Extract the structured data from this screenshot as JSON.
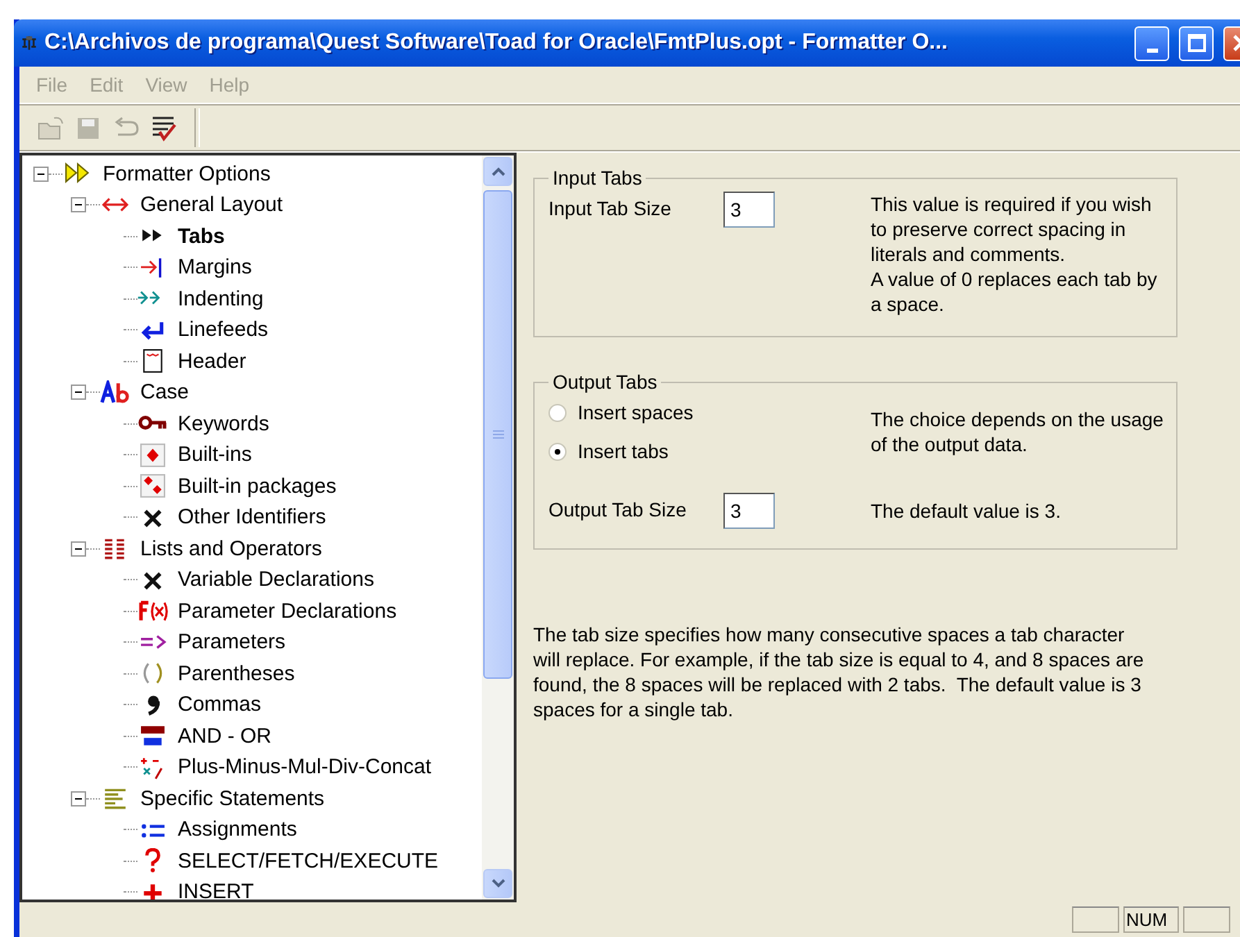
{
  "window": {
    "title": "C:\\Archivos de programa\\Quest Software\\Toad for Oracle\\FmtPlus.opt - Formatter O..."
  },
  "menu": [
    {
      "label": "File",
      "disabled": true
    },
    {
      "label": "Edit",
      "disabled": true
    },
    {
      "label": "View",
      "disabled": true
    },
    {
      "label": "Help",
      "disabled": true
    }
  ],
  "toolbar": [
    {
      "disabled": true
    },
    {
      "disabled": true
    },
    {
      "disabled": true
    },
    {
      "disabled": false
    }
  ],
  "tree": [
    {
      "label": "Formatter Options",
      "expanded": true,
      "selected": false,
      "children": [
        {
          "label": "General Layout",
          "expanded": true,
          "selected": false,
          "children": [
            {
              "label": "Tabs",
              "selected": true
            },
            {
              "label": "Margins",
              "selected": false
            },
            {
              "label": "Indenting",
              "selected": false
            },
            {
              "label": "Linefeeds",
              "selected": false
            },
            {
              "label": "Header",
              "selected": false
            }
          ]
        },
        {
          "label": "Case",
          "expanded": true,
          "selected": false,
          "children": [
            {
              "label": "Keywords",
              "selected": false
            },
            {
              "label": "Built-ins",
              "selected": false
            },
            {
              "label": "Built-in packages",
              "selected": false
            },
            {
              "label": "Other Identifiers",
              "selected": false
            }
          ]
        },
        {
          "label": "Lists and Operators",
          "expanded": true,
          "selected": false,
          "children": [
            {
              "label": "Variable Declarations",
              "selected": false
            },
            {
              "label": "Parameter Declarations",
              "selected": false
            },
            {
              "label": "Parameters",
              "selected": false
            },
            {
              "label": "Parentheses",
              "selected": false
            },
            {
              "label": "Commas",
              "selected": false
            },
            {
              "label": "AND - OR",
              "selected": false
            },
            {
              "label": "Plus-Minus-Mul-Div-Concat",
              "selected": false
            }
          ]
        },
        {
          "label": "Specific Statements",
          "expanded": true,
          "selected": false,
          "children": [
            {
              "label": "Assignments",
              "selected": false
            },
            {
              "label": "SELECT/FETCH/EXECUTE",
              "selected": false
            },
            {
              "label": "INSERT",
              "selected": false
            }
          ]
        }
      ]
    }
  ],
  "input_tabs": {
    "title": "Input Tabs",
    "size_label": "Input Tab Size",
    "size_value": "3",
    "description": "This value is required if you wish to preserve correct spacing in literals and comments.\nA value of 0 replaces each tab by a space."
  },
  "output_tabs": {
    "title": "Output Tabs",
    "options": [
      {
        "label": "Insert spaces",
        "selected": false
      },
      {
        "label": "Insert tabs",
        "selected": true
      }
    ],
    "choice_description": "The choice depends on the usage of the output data.",
    "size_label": "Output Tab Size",
    "size_value": "3",
    "size_description": "The default value is 3."
  },
  "note": "The tab size specifies how many consecutive spaces a tab character will replace. For example, if the tab size is equal to 4, and 8 spaces are found, the 8 spaces will be replaced with 2 tabs.  The default value is 3 spaces for a single tab.",
  "status_bar": {
    "indicator": "NUM"
  }
}
